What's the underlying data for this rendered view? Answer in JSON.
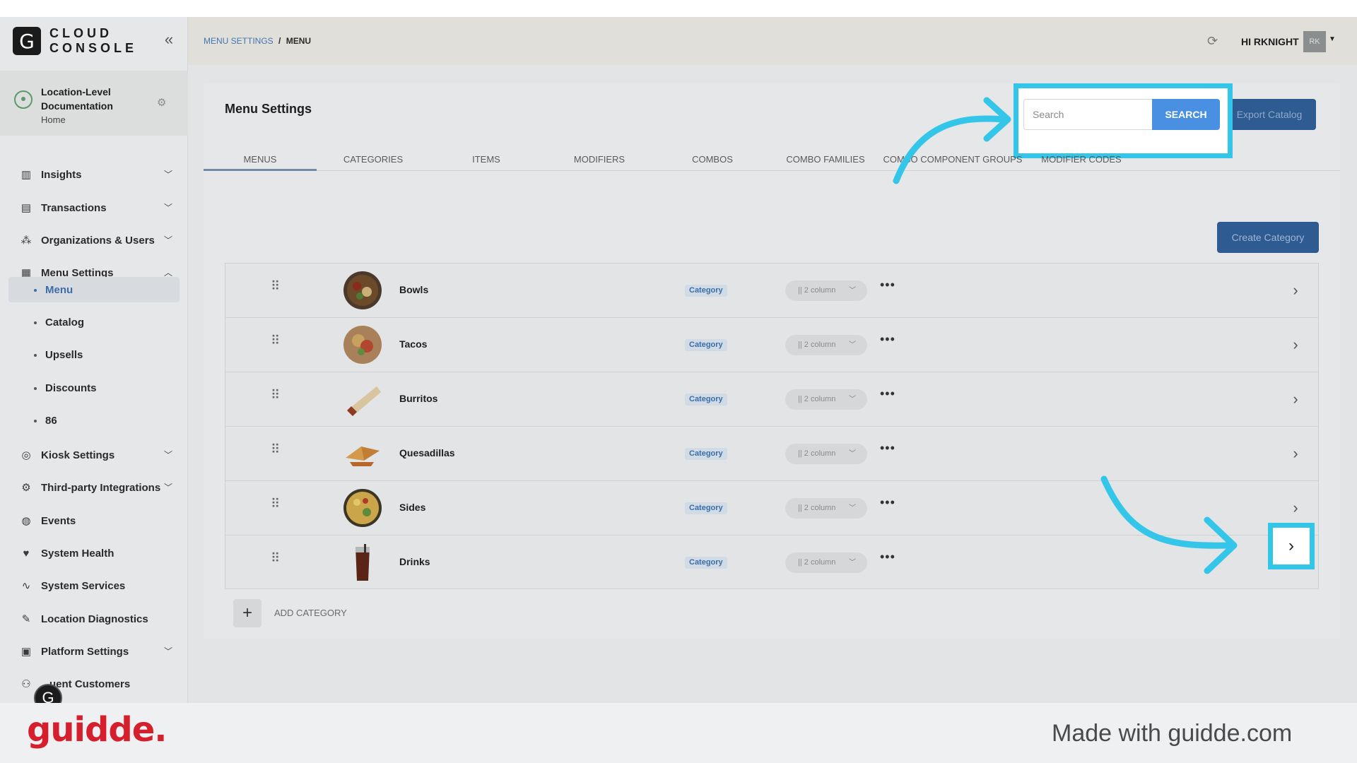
{
  "app": {
    "logo_letter": "G",
    "logo_text_line1": "CLOUD",
    "logo_text_line2": "CONSOLE"
  },
  "location": {
    "name": "Location-Level Documentation",
    "subtitle": "Home"
  },
  "sidebar": {
    "items": [
      {
        "label": "Insights",
        "icon": "chart-icon"
      },
      {
        "label": "Transactions",
        "icon": "receipt-icon"
      },
      {
        "label": "Organizations & Users",
        "icon": "org-icon"
      },
      {
        "label": "Menu Settings",
        "icon": "menu-icon"
      },
      {
        "label": "Kiosk Settings",
        "icon": "kiosk-icon"
      },
      {
        "label": "Third-party Integrations",
        "icon": "gear-icon"
      },
      {
        "label": "Events",
        "icon": "globe-icon"
      },
      {
        "label": "System Health",
        "icon": "heart-icon"
      },
      {
        "label": "System Services",
        "icon": "pulse-icon"
      },
      {
        "label": "Location Diagnostics",
        "icon": "wrench-icon"
      },
      {
        "label": "Platform Settings",
        "icon": "doc-icon"
      },
      {
        "label": "uent Customers",
        "icon": "users-icon"
      }
    ],
    "submenu": [
      {
        "label": "Menu"
      },
      {
        "label": "Catalog"
      },
      {
        "label": "Upsells"
      },
      {
        "label": "Discounts"
      },
      {
        "label": "86"
      }
    ]
  },
  "topbar": {
    "breadcrumb_parent": "MENU SETTINGS",
    "breadcrumb_sep": "/",
    "breadcrumb_current": "MENU",
    "greeting": "HI RKNIGHT",
    "avatar_initials": "RK"
  },
  "page": {
    "title": "Menu Settings",
    "search_placeholder": "Search",
    "search_button": "SEARCH",
    "export_button": "Export Catalog",
    "create_button": "Create Category",
    "add_category_label": "ADD CATEGORY"
  },
  "tabs": [
    {
      "label": "MENUS"
    },
    {
      "label": "CATEGORIES"
    },
    {
      "label": "ITEMS"
    },
    {
      "label": "MODIFIERS"
    },
    {
      "label": "COMBOS"
    },
    {
      "label": "COMBO FAMILIES"
    },
    {
      "label": "COMBO COMPONENT GROUPS"
    },
    {
      "label": "MODIFIER CODES"
    }
  ],
  "rows": [
    {
      "name": "Bowls",
      "badge": "Category",
      "layout": "|| 2 column"
    },
    {
      "name": "Tacos",
      "badge": "Category",
      "layout": "|| 2 column"
    },
    {
      "name": "Burritos",
      "badge": "Category",
      "layout": "|| 2 column"
    },
    {
      "name": "Quesadillas",
      "badge": "Category",
      "layout": "|| 2 column"
    },
    {
      "name": "Sides",
      "badge": "Category",
      "layout": "|| 2 column"
    },
    {
      "name": "Drinks",
      "badge": "Category",
      "layout": "|| 2 column"
    }
  ],
  "footer": {
    "brand": "guidde.",
    "made_with": "Made with guidde.com"
  },
  "colors": {
    "highlight": "#34c6e8",
    "primary_button": "#2d5b92",
    "search_button": "#4a90e2",
    "brand_red": "#d61f2c"
  }
}
